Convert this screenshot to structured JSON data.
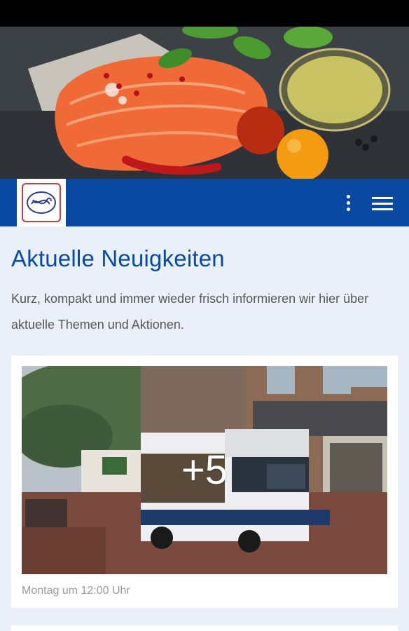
{
  "header": {
    "hero_image": "salmon-fillet-with-herbs-and-oil",
    "logo": "brand-logo-icon",
    "more_icon": "more-vertical-icon",
    "menu_icon": "hamburger-menu-icon",
    "brand_color": "#0a4aa3"
  },
  "main": {
    "title": "Aktuelle Neuigkeiten",
    "intro": "Kurz, kompakt und immer wieder frisch informieren wir hier über aktuelle Themen und Aktionen."
  },
  "news": [
    {
      "image": "market-truck-photo",
      "more_images": "+5",
      "date": "Montag um 12:00 Uhr"
    }
  ]
}
